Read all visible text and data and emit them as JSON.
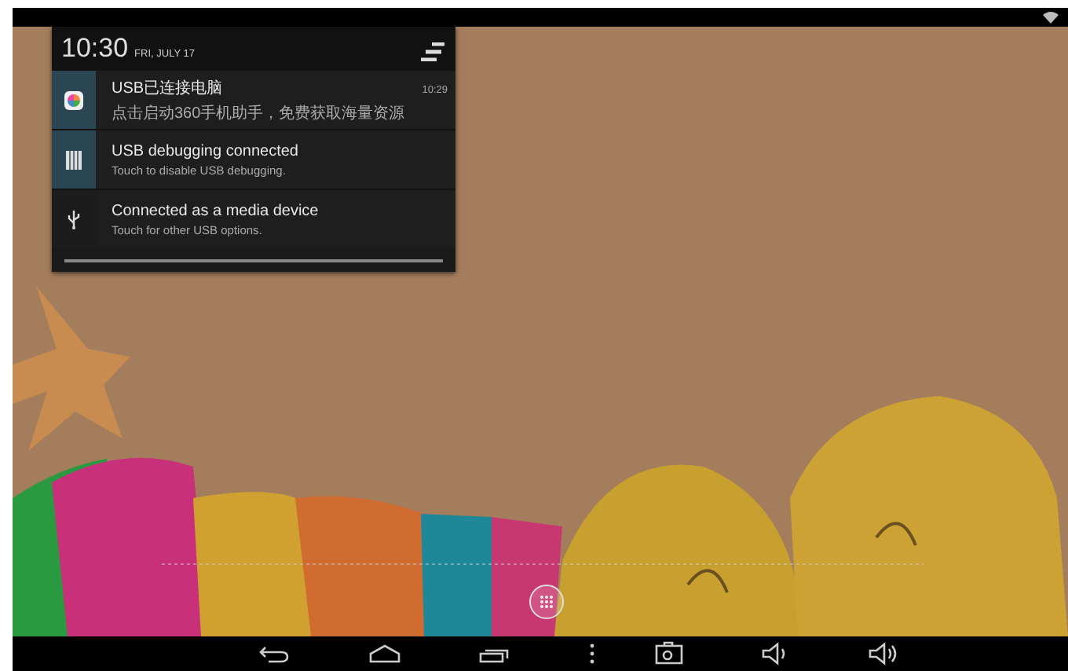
{
  "notification_panel": {
    "time": "10:30",
    "date": "FRI, JULY 17",
    "notifications": [
      {
        "kind": "app",
        "title": "USB已连接电脑",
        "text": "点击启动360手机助手，免费获取海量资源",
        "time": "10:29"
      },
      {
        "kind": "debug",
        "title": "USB debugging connected",
        "text": "Touch to disable USB debugging."
      },
      {
        "kind": "usb",
        "title": "Connected as a media device",
        "text": "Touch for other USB options."
      }
    ]
  }
}
